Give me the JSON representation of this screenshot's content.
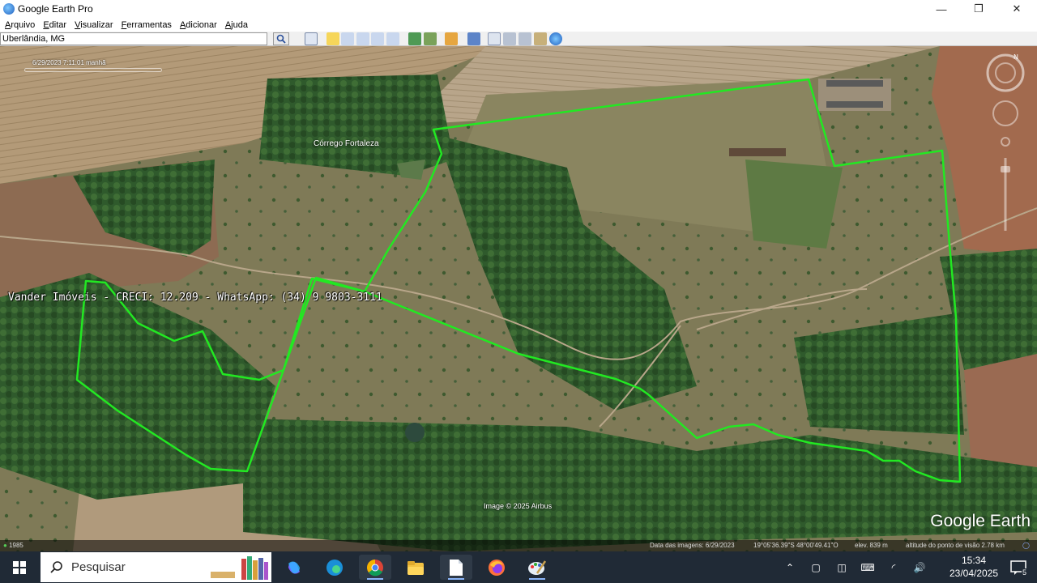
{
  "window": {
    "title": "Google Earth Pro",
    "controls": {
      "minimize": "—",
      "maximize": "❐",
      "close": "✕"
    }
  },
  "menu": [
    "Arquivo",
    "Editar",
    "Visualizar",
    "Ferramentas",
    "Adicionar",
    "Ajuda"
  ],
  "search": {
    "value": "Uberlândia, MG"
  },
  "toolbar_icons": [
    "sidebar-toggle-icon",
    "placemark-icon",
    "polygon-icon",
    "path-icon",
    "image-overlay-icon",
    "record-tour-icon",
    "historical-imagery-icon",
    "sun-icon",
    "planets-icon",
    "ruler-icon",
    "email-icon",
    "print-icon",
    "save-image-icon",
    "view-in-maps-icon",
    "earth-icon"
  ],
  "map": {
    "timestamp": "6/29/2023  7:11:01 manhã",
    "place_label": "Córrego Fortaleza",
    "watermark": "Vander Imóveis - CRECI: 12.209 - WhatsApp: (34) 9 9803-3111",
    "image_credit": "Image © 2025 Airbus",
    "logo": "Google Earth",
    "boundary_color": "#22e822"
  },
  "statusbar": {
    "year": "1985",
    "imagery_date": "Data das imagens: 6/29/2023",
    "coordinates": "19°05'36.39\"S   48°00'49.41\"O",
    "elevation": "elev.  839 m",
    "eye_altitude": "altitude do ponto de visão   2.78 km"
  },
  "taskbar": {
    "search_placeholder": "Pesquisar",
    "apps": [
      "copilot-icon",
      "edge-icon",
      "chrome-icon",
      "file-explorer-icon",
      "notepad-icon",
      "firefox-icon",
      "paint-icon"
    ],
    "time": "15:34",
    "date": "23/04/2025",
    "notifications": "5"
  }
}
